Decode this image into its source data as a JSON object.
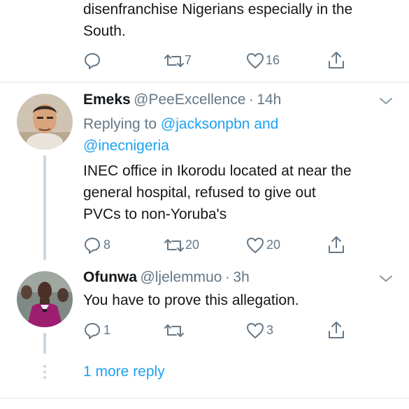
{
  "tweet_top": {
    "text": "disenfranchise Nigerians especially in the South.",
    "line1": "disenfranchise Nigerians especially in the",
    "line2": "South.",
    "reply_count": "",
    "retweet_count": "7",
    "like_count": "16"
  },
  "reply1": {
    "name": "Emeks",
    "handle": "@PeeExcellence",
    "sep": "·",
    "time": "14h",
    "replying_prefix": "Replying to",
    "mention1": "@jacksonpbn",
    "and": "and",
    "mention2": "@inecnigeria",
    "line1": "INEC office in Ikorodu located at near the",
    "line2": "general hospital, refused to give out",
    "line3": "PVCs to non-Yoruba's",
    "reply_count": "8",
    "retweet_count": "20",
    "like_count": "20"
  },
  "reply2": {
    "name": "Ofunwa",
    "handle": "@ljelemmuo",
    "sep": "·",
    "time": "3h",
    "text": "You have to prove this allegation.",
    "reply_count": "1",
    "retweet_count": "",
    "like_count": "3"
  },
  "more_replies": {
    "label": "1 more reply"
  },
  "colors": {
    "accent": "#1da1f2",
    "muted": "#657786",
    "text": "#14171a",
    "line": "#ccd6dd"
  },
  "icons": [
    "reply-icon",
    "retweet-icon",
    "like-icon",
    "share-icon",
    "chevron-down-icon"
  ]
}
